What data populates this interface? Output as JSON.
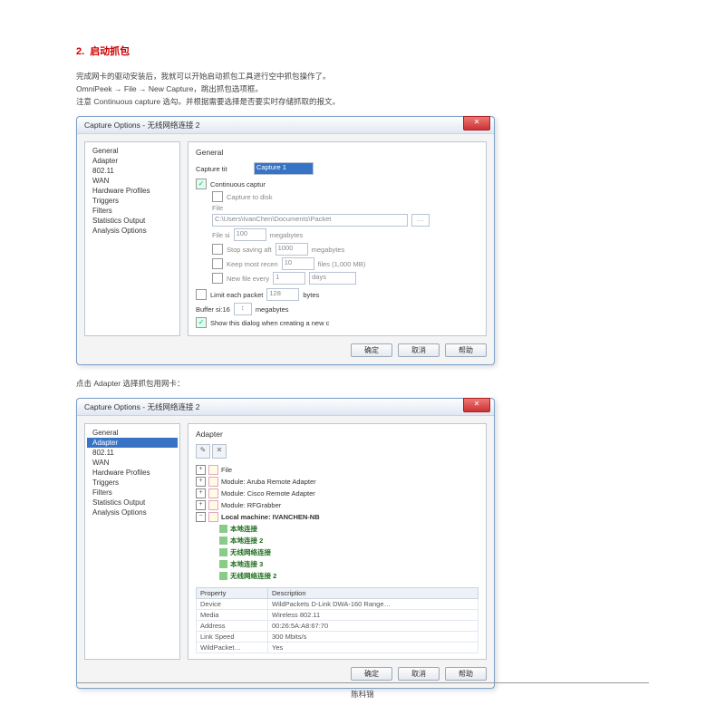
{
  "heading": {
    "num": "2.",
    "text": "启动抓包"
  },
  "intro": [
    "完成网卡的驱动安装后，我就可以开始启动抓包工具进行空中抓包操作了。",
    "OmniPeek → File → New Capture，跳出抓包选项框。",
    "注意 Continuous capture 选勾。并根据需要选择是否要实时存储抓取的报文。"
  ],
  "dlg1": {
    "title": "Capture Options - 无线网络连接 2",
    "sidebar": [
      "General",
      "Adapter",
      "802.11",
      "WAN",
      "Hardware Profiles",
      "Triggers",
      "Filters",
      "Statistics Output",
      "Analysis Options"
    ],
    "panel_title": "General",
    "capture_tit_label": "Capture tit",
    "capture_tit_value": "Capture 1",
    "continuous": "Continuous captur",
    "capture_to_disk": "Capture to disk",
    "file_label": "File",
    "file_path": "C:\\Users\\IvanChen\\Documents\\Packet",
    "file_si_label": "File si",
    "file_si": "100",
    "file_si_unit": "megabytes",
    "stop_label": "Stop saving aft",
    "stop_val": "1000",
    "stop_unit": "megabytes",
    "keep_label": "Keep most recen",
    "keep_val": "10",
    "keep_unit": "files (1,000 MB)",
    "newfile_label": "New file every",
    "newfile_val": "1",
    "newfile_unit": "days",
    "limit_label": "Limit each packet",
    "limit_val": "128",
    "limit_unit": "bytes",
    "buffer_label": "Buffer si:16",
    "buffer_unit": "megabytes",
    "show_label": "Show this dialog when creating a new c",
    "ok": "确定",
    "cancel": "取消",
    "help": "帮助"
  },
  "mid": "点击 Adapter 选择抓包用网卡：",
  "dlg2": {
    "title": "Capture Options - 无线网络连接 2",
    "sidebar": [
      "General",
      "Adapter",
      "802.11",
      "WAN",
      "Hardware Profiles",
      "Triggers",
      "Filters",
      "Statistics Output",
      "Analysis Options"
    ],
    "panel_title": "Adapter",
    "tree": {
      "file": "File",
      "m1": "Module: Aruba Remote Adapter",
      "m2": "Module: Cisco Remote Adapter",
      "m3": "Module: RFGrabber",
      "local": "Local machine: IVANCHEN-NB",
      "a1": "本地连接",
      "a2": "本地连接 2",
      "a3": "无线网络连接",
      "a4": "本地连接 3",
      "a5": "无线网络连接 2"
    },
    "props": {
      "h1": "Property",
      "h2": "Description",
      "r1k": "Device",
      "r1v": "WildPackets D-Link DWA-160 Range…",
      "r2k": "Media",
      "r2v": "Wireless 802.11",
      "r3k": "Address",
      "r3v": "00:26:5A:A8:67:70",
      "r4k": "Link Speed",
      "r4v": "300 Mbits/s",
      "r5k": "WildPacket…",
      "r5v": "Yes"
    },
    "ok": "确定",
    "cancel": "取消",
    "help": "帮助"
  },
  "footer": "陈科锦"
}
